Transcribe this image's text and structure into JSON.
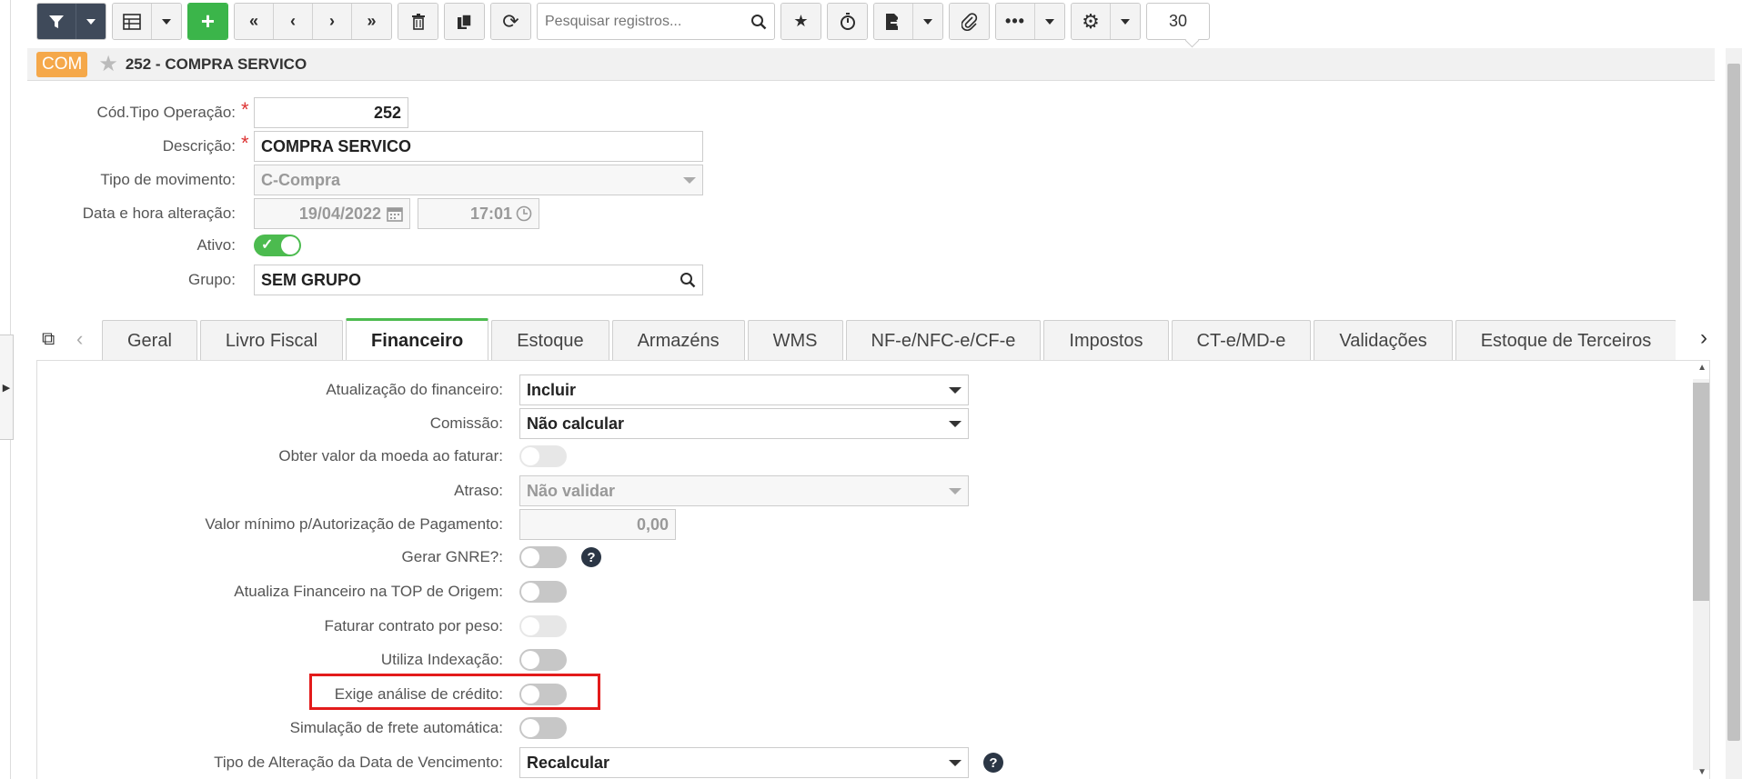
{
  "toolbar": {
    "search_placeholder": "Pesquisar registros...",
    "page_size": "30"
  },
  "header": {
    "badge": "COM",
    "title": "252 - COMPRA SERVICO"
  },
  "form": {
    "cod_tipo_label": "Cód.Tipo Operação:",
    "cod_tipo_value": "252",
    "descricao_label": "Descrição:",
    "descricao_value": "COMPRA SERVICO",
    "tipo_mov_label": "Tipo de movimento:",
    "tipo_mov_value": "C-Compra",
    "data_label": "Data e hora alteração:",
    "data_value": "19/04/2022",
    "hora_value": "17:01",
    "ativo_label": "Ativo:",
    "grupo_label": "Grupo:",
    "grupo_value": "SEM GRUPO"
  },
  "tabs": [
    {
      "label": "Geral"
    },
    {
      "label": "Livro Fiscal"
    },
    {
      "label": "Financeiro",
      "active": true
    },
    {
      "label": "Estoque"
    },
    {
      "label": "Armazéns"
    },
    {
      "label": "WMS"
    },
    {
      "label": "NF-e/NFC-e/CF-e"
    },
    {
      "label": "Impostos"
    },
    {
      "label": "CT-e/MD-e"
    },
    {
      "label": "Validações"
    },
    {
      "label": "Estoque de Terceiros"
    }
  ],
  "financeiro": {
    "atualizacao_label": "Atualização do financeiro:",
    "atualizacao_value": "Incluir",
    "comissao_label": "Comissão:",
    "comissao_value": "Não calcular",
    "obter_moeda_label": "Obter valor da moeda ao faturar:",
    "atraso_label": "Atraso:",
    "atraso_value": "Não validar",
    "valor_minimo_label": "Valor mínimo p/Autorização de Pagamento:",
    "valor_minimo_value": "0,00",
    "gerar_gnre_label": "Gerar GNRE?:",
    "atualiza_fin_top_label": "Atualiza Financeiro na TOP de Origem:",
    "faturar_peso_label": "Faturar contrato por peso:",
    "utiliza_indexacao_label": "Utiliza Indexação:",
    "exige_analise_label": "Exige análise de crédito:",
    "simulacao_frete_label": "Simulação de frete automática:",
    "tipo_alteracao_label": "Tipo de Alteração da Data de Vencimento:",
    "tipo_alteracao_value": "Recalcular"
  },
  "colors": {
    "accent_green": "#3bb54a",
    "badge_orange": "#f5a84a",
    "highlight_red": "#e31b1b",
    "toolbar_dark": "#3f4a5a"
  }
}
